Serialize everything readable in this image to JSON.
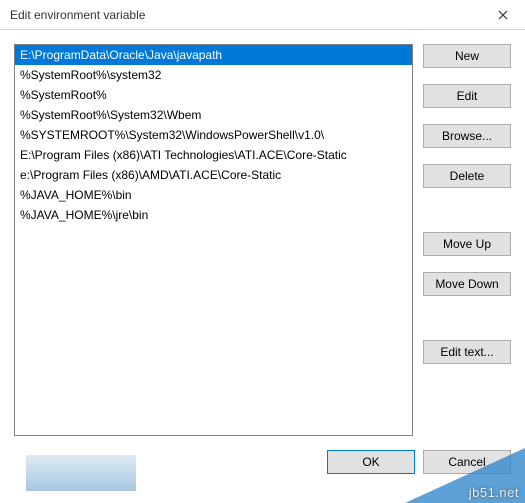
{
  "title": "Edit environment variable",
  "list": {
    "items": [
      "E:\\ProgramData\\Oracle\\Java\\javapath",
      "%SystemRoot%\\system32",
      "%SystemRoot%",
      "%SystemRoot%\\System32\\Wbem",
      "%SYSTEMROOT%\\System32\\WindowsPowerShell\\v1.0\\",
      "E:\\Program Files (x86)\\ATI Technologies\\ATI.ACE\\Core-Static",
      "e:\\Program Files (x86)\\AMD\\ATI.ACE\\Core-Static",
      "%JAVA_HOME%\\bin",
      "%JAVA_HOME%\\jre\\bin"
    ],
    "selected_index": 0
  },
  "buttons": {
    "new": "New",
    "edit": "Edit",
    "browse": "Browse...",
    "delete": "Delete",
    "move_up": "Move Up",
    "move_down": "Move Down",
    "edit_text": "Edit text...",
    "ok": "OK",
    "cancel": "Cancel"
  },
  "watermark": "jb51.net"
}
